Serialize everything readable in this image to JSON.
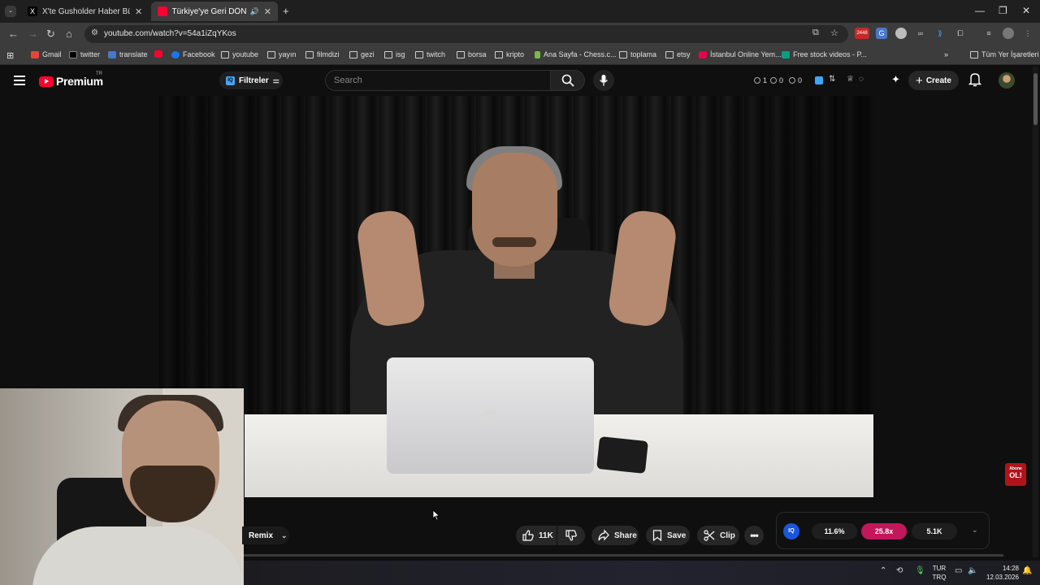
{
  "browser": {
    "tabs": [
      {
        "title": "X'te Gusholder Haber Bülteni: \"",
        "active": false
      },
      {
        "title": "Türkiye'ye Geri DÖNDÜM! (",
        "active": true
      }
    ],
    "url": "youtube.com/watch?v=54a1iZqYKos",
    "extension_badge": "2448",
    "bookmarks": [
      {
        "label": "Gmail",
        "icon": "gmail-icon"
      },
      {
        "label": "twitter",
        "icon": "x-icon"
      },
      {
        "label": "translate",
        "icon": "translate-icon"
      },
      {
        "label": "",
        "icon": "youtube-icon"
      },
      {
        "label": "Facebook",
        "icon": "facebook-icon"
      },
      {
        "label": "youtube",
        "icon": "folder-icon"
      },
      {
        "label": "yayın",
        "icon": "folder-icon"
      },
      {
        "label": "filmdizi",
        "icon": "folder-icon"
      },
      {
        "label": "gezi",
        "icon": "folder-icon"
      },
      {
        "label": "isg",
        "icon": "folder-icon"
      },
      {
        "label": "twitch",
        "icon": "folder-icon"
      },
      {
        "label": "borsa",
        "icon": "folder-icon"
      },
      {
        "label": "kripto",
        "icon": "folder-icon"
      },
      {
        "label": "Ana Sayfa - Chess.c...",
        "icon": "chess-icon"
      },
      {
        "label": "toplama",
        "icon": "folder-icon"
      },
      {
        "label": "etsy",
        "icon": "folder-icon"
      },
      {
        "label": "İstanbul Online Yem...",
        "icon": "yemeksepeti-icon"
      },
      {
        "label": "Free stock videos - P...",
        "icon": "pexels-icon"
      }
    ],
    "all_bookmarks": "Tüm Yer İşaretleri"
  },
  "youtube": {
    "logo_text": "Premium",
    "logo_country": "TR",
    "filters_label": "Filtreler",
    "search_placeholder": "Search",
    "header_stats": [
      "1",
      "0",
      "0"
    ],
    "create_label": "Create"
  },
  "video": {
    "overlay_badge_line1": "Abone",
    "overlay_badge_line2": "OL!"
  },
  "actions": {
    "remix": "Remix",
    "likes": "11K",
    "share": "Share",
    "save": "Save",
    "clip": "Clip"
  },
  "stats": {
    "logo": "IQ",
    "percent": "11.6%",
    "multiplier": "25.8x",
    "count": "5.1K",
    "multiplier_color": "#c2185b"
  },
  "taskbar": {
    "lang_top": "TUR",
    "lang_bottom": "TRQ",
    "time": "14:28",
    "date": "12.03.2026"
  },
  "colors": {
    "accent": "#ff0033",
    "bg": "#0f0f0f"
  }
}
